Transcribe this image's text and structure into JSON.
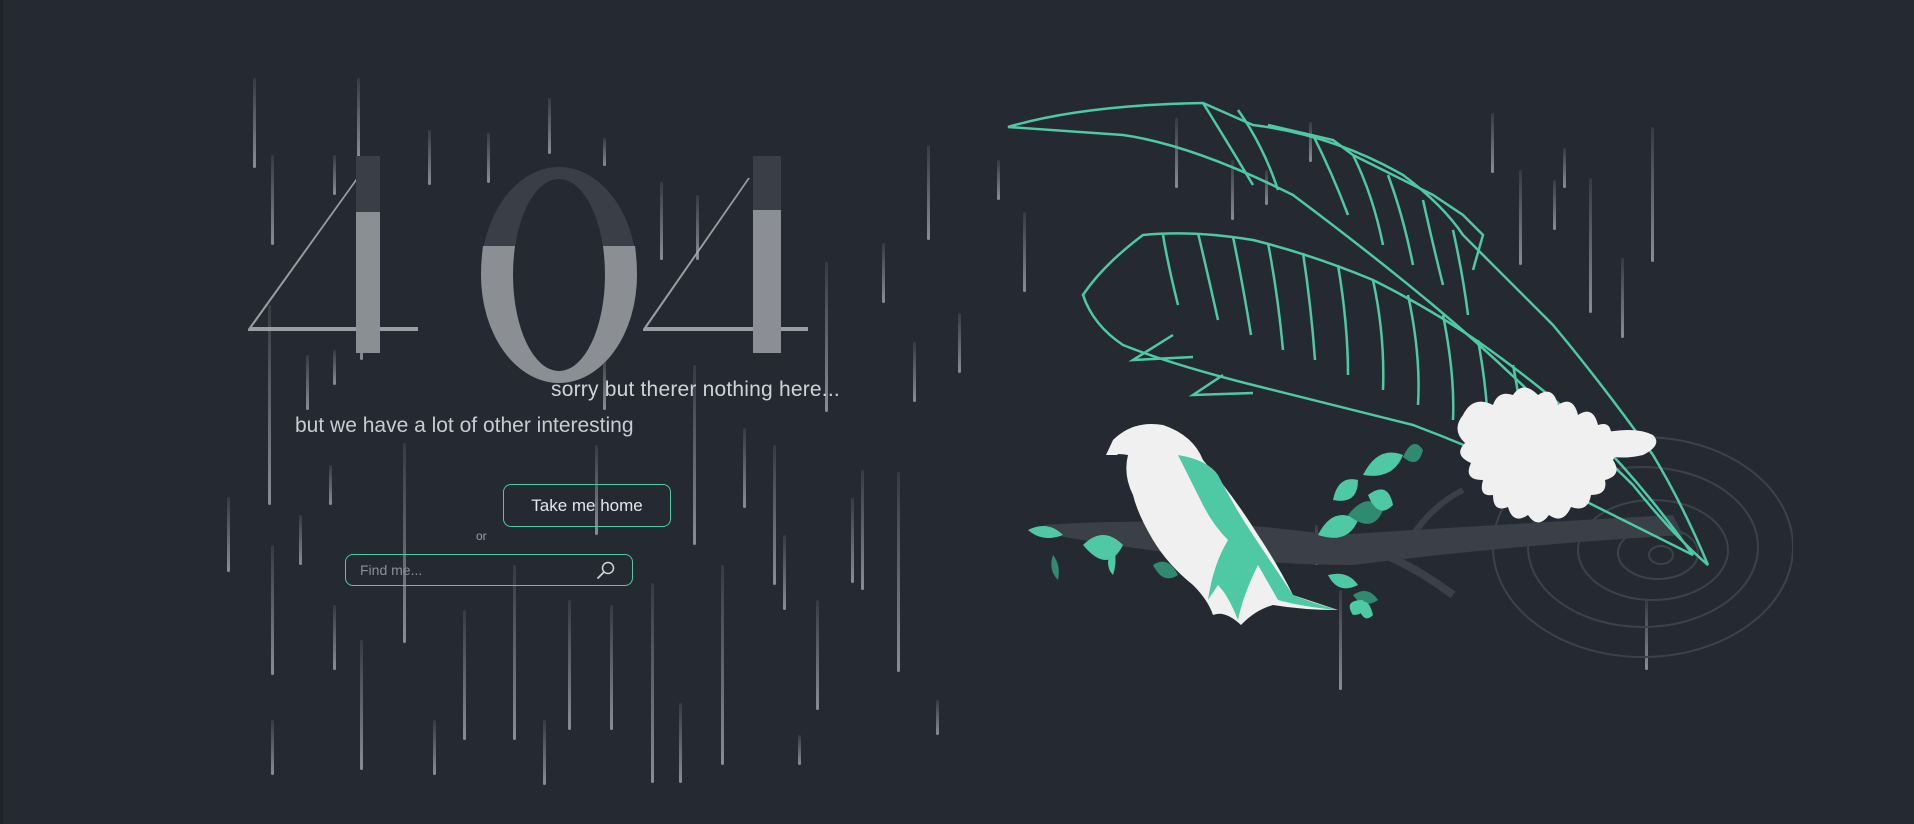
{
  "error": {
    "code": "404",
    "message": "sorry but therer nothing here...",
    "tagline": "but we have a lot of other interesting"
  },
  "actions": {
    "home_label": "Take me home",
    "or_label": "or",
    "search_placeholder": "Find me...",
    "search_value": ""
  },
  "icons": {
    "search": "search-icon",
    "illustration": "bird-on-branch-illustration"
  },
  "colors": {
    "background": "#252a32",
    "accent": "#4ec9a3",
    "digit_fill": "#8b8e93",
    "bird_white": "#f0f0f0",
    "rain": "#9aa0a8"
  }
}
